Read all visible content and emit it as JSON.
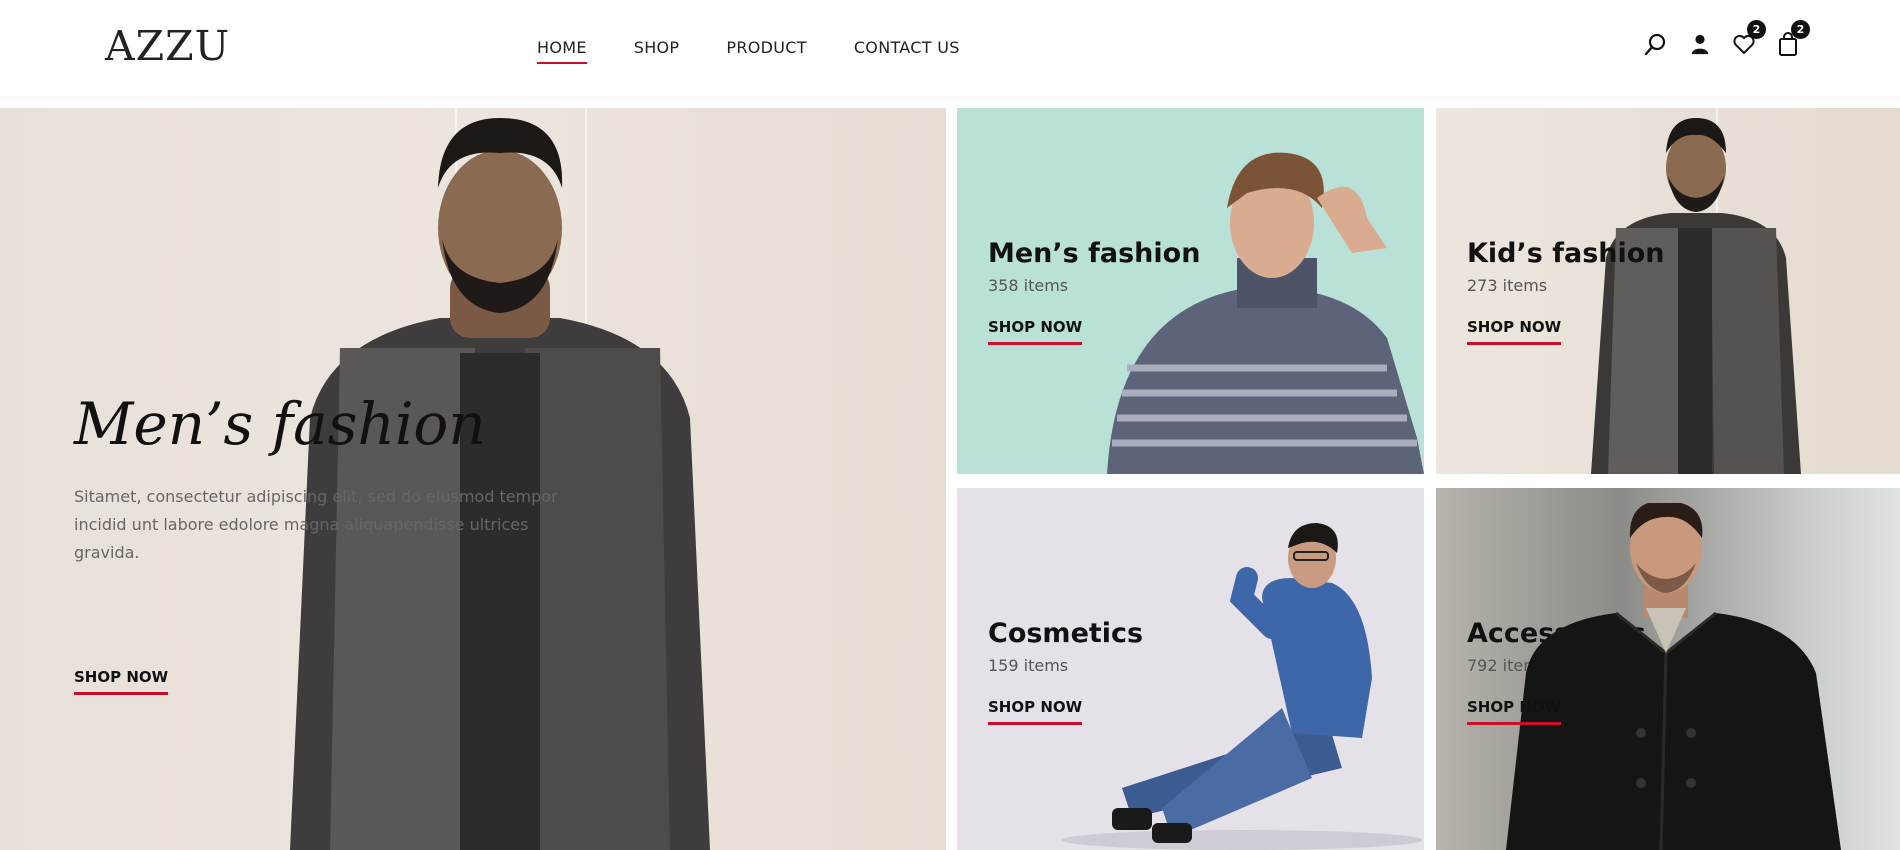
{
  "header": {
    "logo": "AZZU",
    "nav": [
      {
        "label": "HOME"
      },
      {
        "label": "SHOP"
      },
      {
        "label": "PRODUCT"
      },
      {
        "label": "CONTACT US"
      }
    ],
    "wishlist_count": "2",
    "cart_count": "2"
  },
  "hero": {
    "title": "Men’s fashion",
    "description": "Sitamet, consectetur adipiscing elit, sed do eiusmod tempor incidid unt labore edolore magna aliquapendisse ultrices gravida.",
    "cta": "SHOP NOW"
  },
  "categories": [
    {
      "title": "Men’s fashion",
      "count": "358 items",
      "cta": "SHOP NOW"
    },
    {
      "title": "Kid’s fashion",
      "count": "273 items",
      "cta": "SHOP NOW"
    },
    {
      "title": "Cosmetics",
      "count": "159 items",
      "cta": "SHOP NOW"
    },
    {
      "title": "Accessories",
      "count": "792 items",
      "cta": "SHOP NOW"
    }
  ],
  "colors": {
    "accent": "#c8102e",
    "mint": "#b9e1d7"
  }
}
